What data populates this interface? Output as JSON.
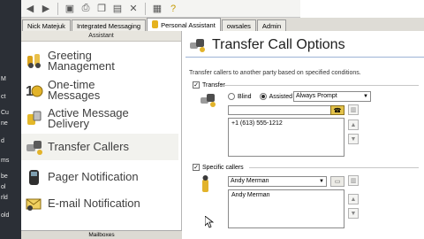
{
  "toolbar": {
    "buttons": [
      "back-icon",
      "forward-icon",
      "save-icon",
      "print-icon",
      "copy-icon",
      "paste-icon",
      "delete-icon",
      "settings-icon",
      "help-icon"
    ]
  },
  "tabs": [
    {
      "label": "Nick Matejuk"
    },
    {
      "label": "Integrated Messaging"
    },
    {
      "label": "Personal Assistant"
    },
    {
      "label": "owsales"
    },
    {
      "label": "Admin"
    }
  ],
  "left_strip": {
    "fragments": [
      "M",
      "ct",
      "Cu",
      "ne",
      "d",
      "ms",
      "be",
      "ol",
      "rld",
      "old"
    ]
  },
  "assistant": {
    "header": "Assistant",
    "items": [
      {
        "label": "Greeting Management",
        "icon": "greeting-icon"
      },
      {
        "label": "One-time Messages",
        "icon": "one-time-icon"
      },
      {
        "label": "Active Message Delivery",
        "icon": "delivery-icon"
      },
      {
        "label": "Transfer Callers",
        "icon": "transfer-icon"
      },
      {
        "label": "Pager Notification",
        "icon": "pager-icon"
      },
      {
        "label": "E-mail Notification",
        "icon": "email-icon"
      }
    ],
    "footer": "Mailboxes"
  },
  "main": {
    "title": "Transfer Call Options",
    "description": "Transfer callers to another party based on specified conditions.",
    "transfer_label": "Transfer",
    "blind_label": "Blind",
    "assisted_label": "Assisted",
    "prompt_value": "Always Prompt",
    "phone_entry": "+1 (613) 555-1212",
    "specific_callers_label": "Specific callers",
    "caller_select": "Andy Merman",
    "caller_entry": "Andy Merman"
  }
}
